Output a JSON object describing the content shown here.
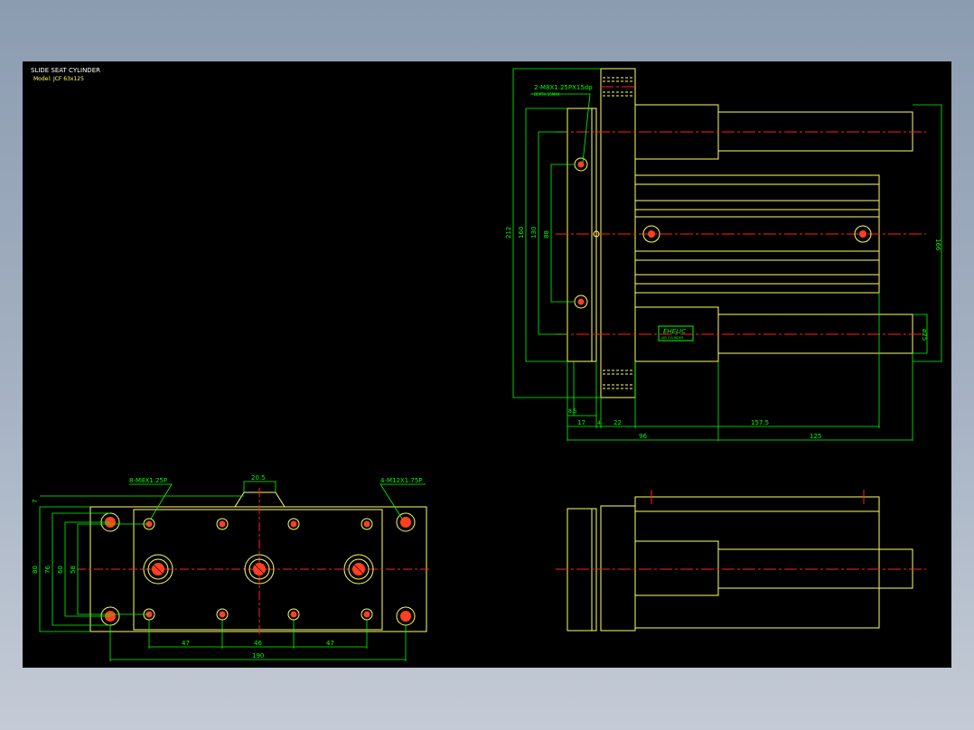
{
  "title": {
    "main": "SLIDE SEAT CYLINDER",
    "model": "Model: JCF 63x125"
  },
  "colors": {
    "background": "#000000",
    "outline": "#ffff66",
    "dimension": "#00ff00",
    "center_line": "#ff2020",
    "hole_fill": "#ff4020",
    "page_backdrop": "#9aa8ba"
  },
  "front_view": {
    "callouts": {
      "tapped_top": "2-M8X1.25PX15dp",
      "tapped_top_sub": "DEPTH 15MAX"
    },
    "dims_vertical": {
      "overall": "212",
      "rail_span": "160",
      "mount_span": "130",
      "hole_span": "88",
      "right_height": "166",
      "rod_diameter": "ø25"
    },
    "dims_horizontal": {
      "offset": "8.5",
      "plate": "17",
      "gap": "4",
      "body": "22",
      "stroke_total": "157.5",
      "base": "96",
      "stroke": "125"
    },
    "logo": {
      "brand": "EHELIC",
      "sub": "AIR CYLINDER"
    }
  },
  "bottom_view": {
    "callouts": {
      "holes_small": "8-M8X1.25P",
      "holes_large": "4-M12X1.75P"
    },
    "dims": {
      "top_width": "20.5",
      "top_offset": "7",
      "h_overall": "80",
      "h_76": "76",
      "h_60": "60",
      "h_58": "58",
      "spacing_left": "47",
      "spacing_mid": "46",
      "spacing_right": "47",
      "total": "190"
    }
  }
}
